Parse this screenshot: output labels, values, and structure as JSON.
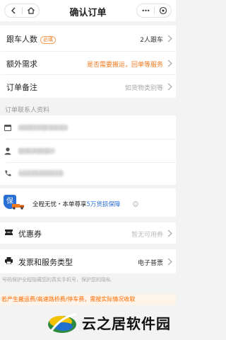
{
  "header": {
    "title": "确认订单",
    "more_label": "•••"
  },
  "order": {
    "followers": {
      "label": "跟车人数",
      "required": "必填",
      "value": "2人跟车"
    },
    "extra_needs": {
      "label": "额外需求",
      "value": "是否需要搬运，回单等服务"
    },
    "remark": {
      "label": "订单备注",
      "placeholder": "如货物类别等"
    }
  },
  "contact": {
    "section_title": "订单联系人资料",
    "time_value": "05月27日 14:23",
    "name_value": "联系人姓名",
    "phone_value": "15736298975"
  },
  "insurance": {
    "text": "全程无忧・本单尊享",
    "highlight": "5万货损保障",
    "badge": "保"
  },
  "coupon": {
    "label": "优惠券",
    "value": "暂无可用券"
  },
  "invoice": {
    "label": "发票和服务类型",
    "value": "电子普票"
  },
  "phone_note": "号码保护全程隐藏您的真实手机号，保护您的隐私",
  "promo_text": "若产生搬运费/高速路桥费/停车费，需按实际情况收取",
  "watermark": {
    "text": "云之居软件园"
  },
  "colors": {
    "accent": "#f07a20",
    "blue": "#2a6fd6",
    "orange_bg": "#fff4ea"
  }
}
